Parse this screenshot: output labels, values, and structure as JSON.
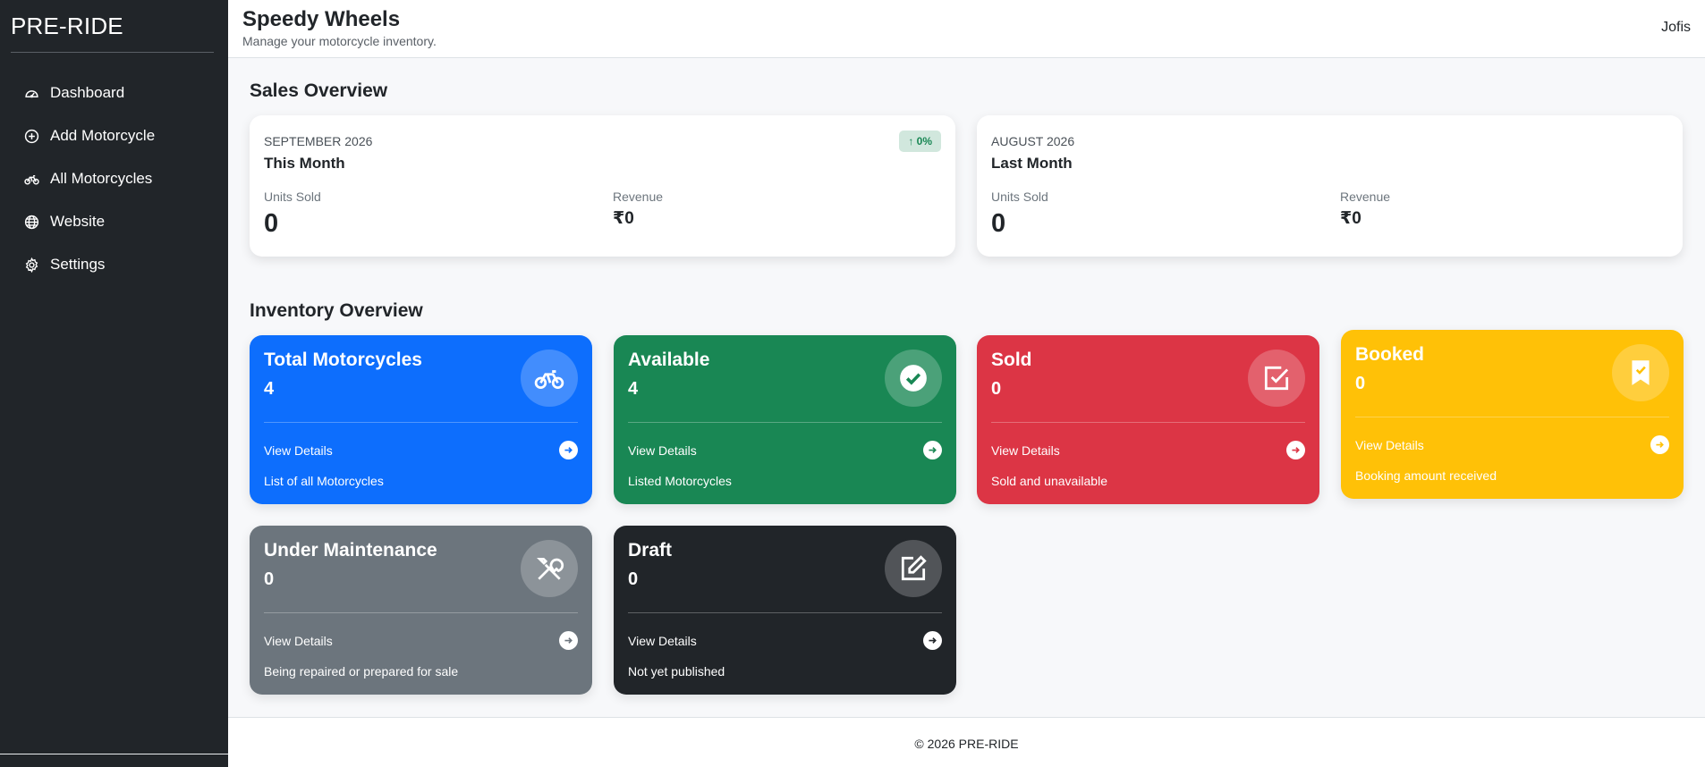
{
  "sidebar": {
    "brand": "PRE-RIDE",
    "items": [
      {
        "label": "Dashboard",
        "icon": "speedometer-icon"
      },
      {
        "label": "Add Motorcycle",
        "icon": "plus-circle-icon"
      },
      {
        "label": "All Motorcycles",
        "icon": "bicycle-icon"
      },
      {
        "label": "Website",
        "icon": "globe-icon"
      },
      {
        "label": "Settings",
        "icon": "gear-icon"
      }
    ]
  },
  "header": {
    "title": "Speedy Wheels",
    "subtitle": "Manage your motorcycle inventory.",
    "user": "Jofis"
  },
  "sales": {
    "title": "Sales Overview",
    "this_month": {
      "period": "SEPTEMBER 2026",
      "label": "This Month",
      "units_label": "Units Sold",
      "units": "0",
      "revenue_label": "Revenue",
      "revenue": "₹0",
      "change": "↑ 0%"
    },
    "last_month": {
      "period": "AUGUST 2026",
      "label": "Last Month",
      "units_label": "Units Sold",
      "units": "0",
      "revenue_label": "Revenue",
      "revenue": "₹0"
    }
  },
  "inventory": {
    "title": "Inventory Overview",
    "cards": [
      {
        "title": "Total Motorcycles",
        "count": "4",
        "link": "View Details",
        "desc": "List of all Motorcycles",
        "icon": "bicycle-icon",
        "color": "#0d6efd"
      },
      {
        "title": "Available",
        "count": "4",
        "link": "View Details",
        "desc": "Listed Motorcycles",
        "icon": "check-circle-icon",
        "color": "#198754"
      },
      {
        "title": "Sold",
        "count": "0",
        "link": "View Details",
        "desc": "Sold and unavailable",
        "icon": "check-square-icon",
        "color": "#dc3545"
      },
      {
        "title": "Booked",
        "count": "0",
        "link": "View Details",
        "desc": "Booking amount received",
        "icon": "bookmark-check-icon",
        "color": "#ffc107"
      },
      {
        "title": "Under Maintenance",
        "count": "0",
        "link": "View Details",
        "desc": "Being repaired or prepared for sale",
        "icon": "tools-icon",
        "color": "#6c757d"
      },
      {
        "title": "Draft",
        "count": "0",
        "link": "View Details",
        "desc": "Not yet published",
        "icon": "pencil-square-icon",
        "color": "#212529"
      }
    ]
  },
  "footer": {
    "text": "© 2026 PRE-RIDE"
  }
}
